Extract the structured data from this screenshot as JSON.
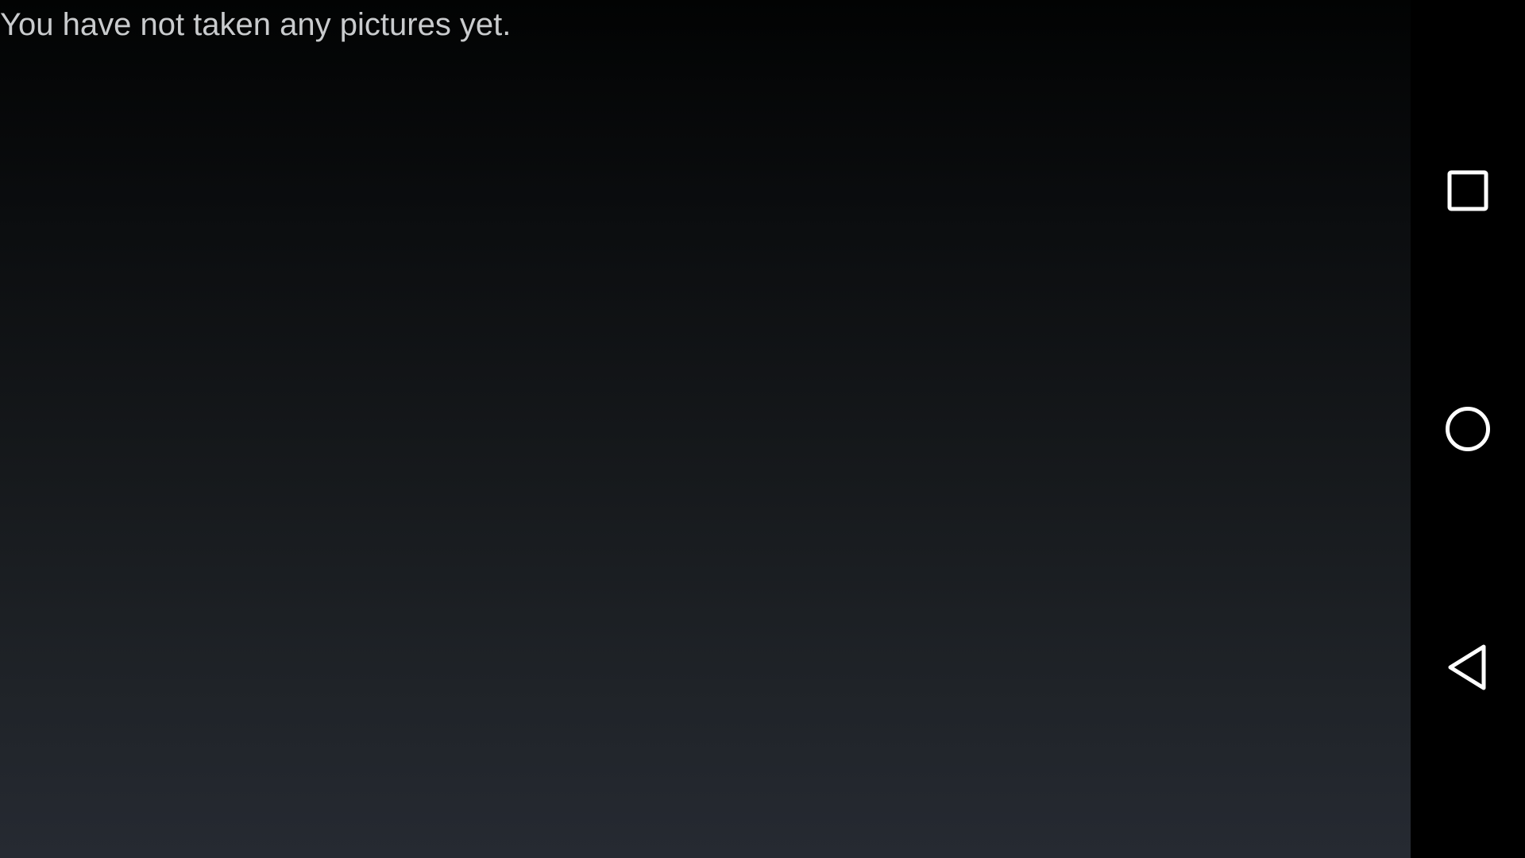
{
  "main": {
    "empty_message": "You have not taken any pictures yet."
  },
  "navigation_bar": {
    "buttons": [
      {
        "id": "recents",
        "icon": "square-recents-icon"
      },
      {
        "id": "home",
        "icon": "circle-home-icon"
      },
      {
        "id": "back",
        "icon": "triangle-back-icon"
      }
    ],
    "icon_color": "#ffffff",
    "background": "#000000"
  }
}
